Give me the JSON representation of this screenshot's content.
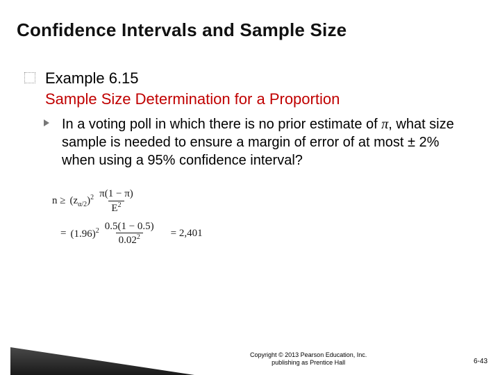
{
  "title": "Confidence Intervals and Sample Size",
  "example_label": "Example 6.15",
  "subtitle": "Sample Size Determination for a Proportion",
  "body_pre": "In a voting poll in which there is no prior estimate of ",
  "body_pi": "π",
  "body_post": ", what size sample is needed to ensure a margin of error of at most ± 2% when using a 95% confidence interval?",
  "formula": {
    "lhs": "n ≥",
    "z_base": "(z",
    "z_sub": "α/2",
    "z_close": ")",
    "z_sup": "2",
    "frac1_num": "π(1 − π)",
    "frac1_den_base": "E",
    "frac1_den_sup": "2",
    "eq": "=",
    "num_value": "(1.96)",
    "num_value_sup": "2",
    "frac2_num": "0.5(1 − 0.5)",
    "frac2_den_base": "0.02",
    "frac2_den_sup": "2",
    "result": "= 2,401"
  },
  "copyright_line1": "Copyright © 2013 Pearson Education, Inc.",
  "copyright_line2": "publishing as Prentice Hall",
  "page_number": "6-43"
}
